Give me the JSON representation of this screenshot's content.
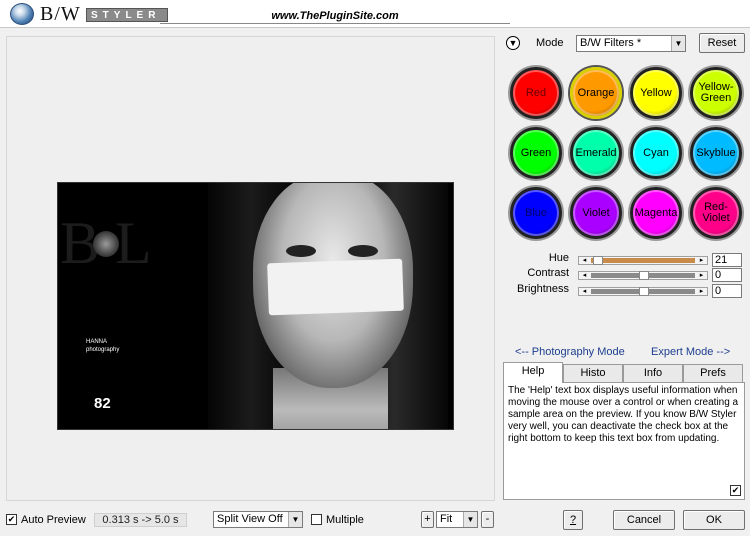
{
  "header": {
    "logo_text": "B/W",
    "logo_styler": "STYLER",
    "site_url": "www.ThePluginSite.com"
  },
  "preview": {
    "caption_lines": [
      "HANNA",
      "photography"
    ],
    "number": "82"
  },
  "mode": {
    "label": "Mode",
    "selected": "B/W Filters *",
    "reset_label": "Reset"
  },
  "color_filters": [
    {
      "label": "Red",
      "color": "#ff0000",
      "text_color": "#660000"
    },
    {
      "label": "Orange",
      "color": "#ff9900",
      "text_color": "#000000"
    },
    {
      "label": "Yellow",
      "color": "#ffff00",
      "text_color": "#000000"
    },
    {
      "label": "Yellow-\nGreen",
      "color": "#ccff00",
      "text_color": "#000000"
    },
    {
      "label": "Green",
      "color": "#00ff00",
      "text_color": "#000000"
    },
    {
      "label": "Emerald",
      "color": "#00ffaa",
      "text_color": "#000000"
    },
    {
      "label": "Cyan",
      "color": "#00ffff",
      "text_color": "#000000"
    },
    {
      "label": "Skyblue",
      "color": "#00bbff",
      "text_color": "#000000"
    },
    {
      "label": "Blue",
      "color": "#0000ff",
      "text_color": "#000066"
    },
    {
      "label": "Violet",
      "color": "#aa00ff",
      "text_color": "#000000"
    },
    {
      "label": "Magenta",
      "color": "#ff00ff",
      "text_color": "#000000"
    },
    {
      "label": "Red-\nViolet",
      "color": "#ff0088",
      "text_color": "#000000"
    }
  ],
  "sliders": [
    {
      "label": "Hue",
      "value": "21",
      "position": 0.04,
      "fill_color": "#c98b4a"
    },
    {
      "label": "Contrast",
      "value": "0",
      "position": 0.5,
      "fill_color": "#8a8a8a"
    },
    {
      "label": "Brightness",
      "value": "0",
      "position": 0.5,
      "fill_color": "#8a8a8a"
    }
  ],
  "links": {
    "photography_mode": "<-- Photography Mode",
    "expert_mode": "Expert Mode -->"
  },
  "tabs": [
    {
      "label": "Help",
      "active": true
    },
    {
      "label": "Histo",
      "active": false
    },
    {
      "label": "Info",
      "active": false
    },
    {
      "label": "Prefs",
      "active": false
    }
  ],
  "help_text": "The 'Help' text box displays useful information when moving the mouse over a control or when creating a sample area on the preview. If you know B/W Styler very well, you can deactivate the check box at the right bottom to keep this text box from updating.",
  "help_checkbox_checked": true,
  "bottom_bar": {
    "auto_preview_label": "Auto Preview",
    "auto_preview_checked": true,
    "timing": "0.313 s -> 5.0 s",
    "view_mode": "Split View Off",
    "multiple_label": "Multiple",
    "multiple_checked": false,
    "zoom_in": "+",
    "zoom_value": "Fit",
    "zoom_out": "-",
    "help_button": "?",
    "cancel_label": "Cancel",
    "ok_label": "OK"
  }
}
